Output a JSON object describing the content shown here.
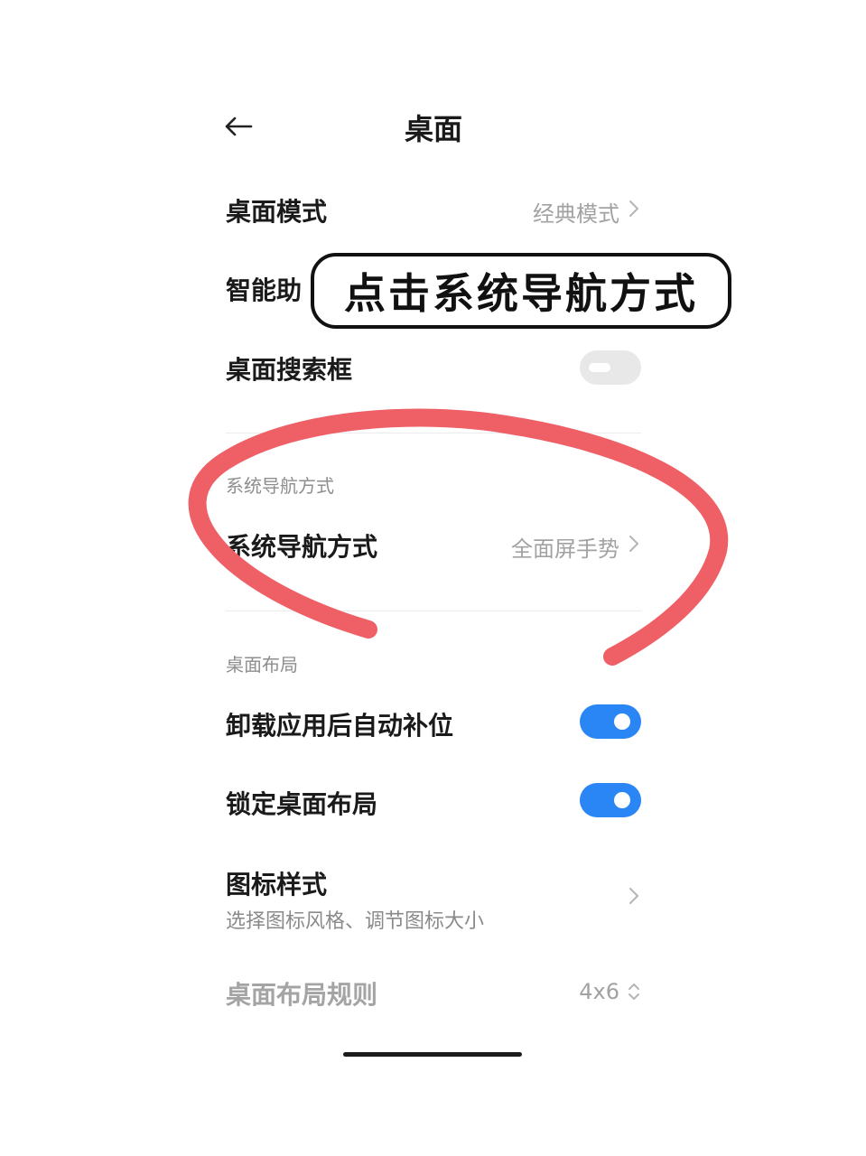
{
  "header": {
    "title": "桌面",
    "back_icon": "back-arrow-icon"
  },
  "rows": {
    "desktop_mode": {
      "label": "桌面模式",
      "value": "经典模式"
    },
    "smart_assistant": {
      "label": "智能助"
    },
    "search_box": {
      "label": "桌面搜索框",
      "toggle": "off"
    },
    "nav_section": {
      "header": "系统导航方式"
    },
    "nav_mode": {
      "label": "系统导航方式",
      "value": "全面屏手势"
    },
    "layout_section": {
      "header": "桌面布局"
    },
    "auto_fill": {
      "label": "卸载应用后自动补位",
      "toggle": "on"
    },
    "lock_layout": {
      "label": "锁定桌面布局",
      "toggle": "on"
    },
    "icon_style": {
      "label": "图标样式",
      "subtitle": "选择图标风格、调节图标大小"
    },
    "layout_rule": {
      "label": "桌面布局规则",
      "value": "4x6"
    }
  },
  "annotation": {
    "callout_text": "点击系统导航方式",
    "circle_color": "#ef5f66"
  },
  "colors": {
    "toggle_on": "#2a86f5",
    "toggle_off": "#e8e8e8",
    "annotation": "#ef5f66"
  }
}
